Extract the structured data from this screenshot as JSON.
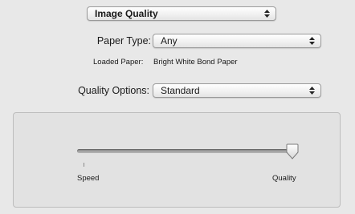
{
  "panel_selector": {
    "value": "Image Quality"
  },
  "paper_type": {
    "label": "Paper Type:",
    "value": "Any"
  },
  "loaded_paper": {
    "label": "Loaded Paper:",
    "value": "Bright White Bond Paper"
  },
  "quality_options": {
    "label": "Quality Options:",
    "value": "Standard"
  },
  "quality_slider": {
    "min_label": "Speed",
    "max_label": "Quality",
    "level": 1.0
  },
  "icons": {
    "popup_arrows": "up-down-arrows-icon"
  },
  "colors": {
    "window_bg": "#e8e8e8",
    "groupbox_bg": "#e2e2e2"
  }
}
